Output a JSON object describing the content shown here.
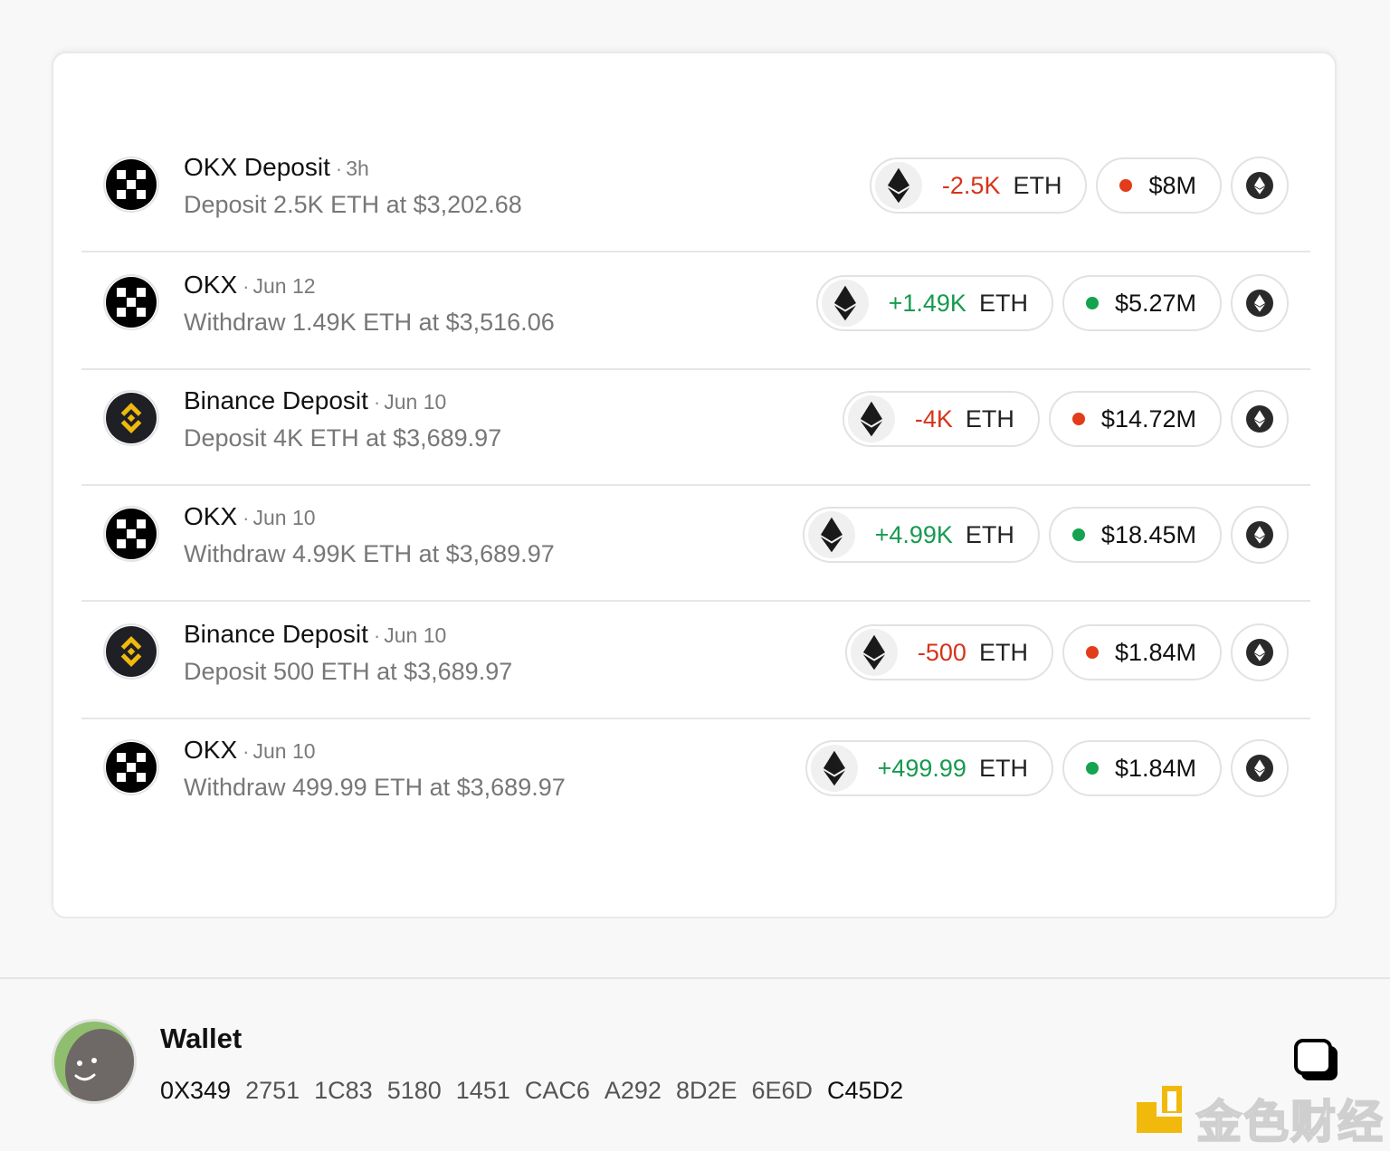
{
  "transactions": [
    {
      "exchange": "okx",
      "title": "OKX Deposit",
      "time": "3h",
      "description": "Deposit 2.5K ETH at $3,202.68",
      "amount": "-2.5K",
      "direction": "neg",
      "unit": "ETH",
      "usd": "$8M",
      "status": "red"
    },
    {
      "exchange": "okx",
      "title": "OKX",
      "time": "Jun 12",
      "description": "Withdraw 1.49K ETH at $3,516.06",
      "amount": "+1.49K",
      "direction": "pos",
      "unit": "ETH",
      "usd": "$5.27M",
      "status": "green"
    },
    {
      "exchange": "binance",
      "title": "Binance Deposit",
      "time": "Jun 10",
      "description": "Deposit 4K ETH at $3,689.97",
      "amount": "-4K",
      "direction": "neg",
      "unit": "ETH",
      "usd": "$14.72M",
      "status": "red"
    },
    {
      "exchange": "okx",
      "title": "OKX",
      "time": "Jun 10",
      "description": "Withdraw 4.99K ETH at $3,689.97",
      "amount": "+4.99K",
      "direction": "pos",
      "unit": "ETH",
      "usd": "$18.45M",
      "status": "green"
    },
    {
      "exchange": "binance",
      "title": "Binance Deposit",
      "time": "Jun 10",
      "description": "Deposit 500 ETH at $3,689.97",
      "amount": "-500",
      "direction": "neg",
      "unit": "ETH",
      "usd": "$1.84M",
      "status": "red"
    },
    {
      "exchange": "okx",
      "title": "OKX",
      "time": "Jun 10",
      "description": "Withdraw 499.99 ETH at $3,689.97",
      "amount": "+499.99",
      "direction": "pos",
      "unit": "ETH",
      "usd": "$1.84M",
      "status": "green"
    }
  ],
  "wallet": {
    "label": "Wallet",
    "address_groups": [
      "0X349",
      "2751",
      "1C83",
      "5180",
      "1451",
      "CAC6",
      "A292",
      "8D2E",
      "6E6D",
      "C45D2"
    ]
  },
  "watermark": {
    "text": "金色财经"
  },
  "icons": {
    "okx_logo": "okx-logo-icon",
    "binance_logo": "binance-logo-icon",
    "eth": "ethereum-icon",
    "copy": "copy-icon"
  },
  "colors": {
    "negative": "#d6341a",
    "positive": "#169a4f",
    "binance_yellow": "#f0b90b"
  }
}
